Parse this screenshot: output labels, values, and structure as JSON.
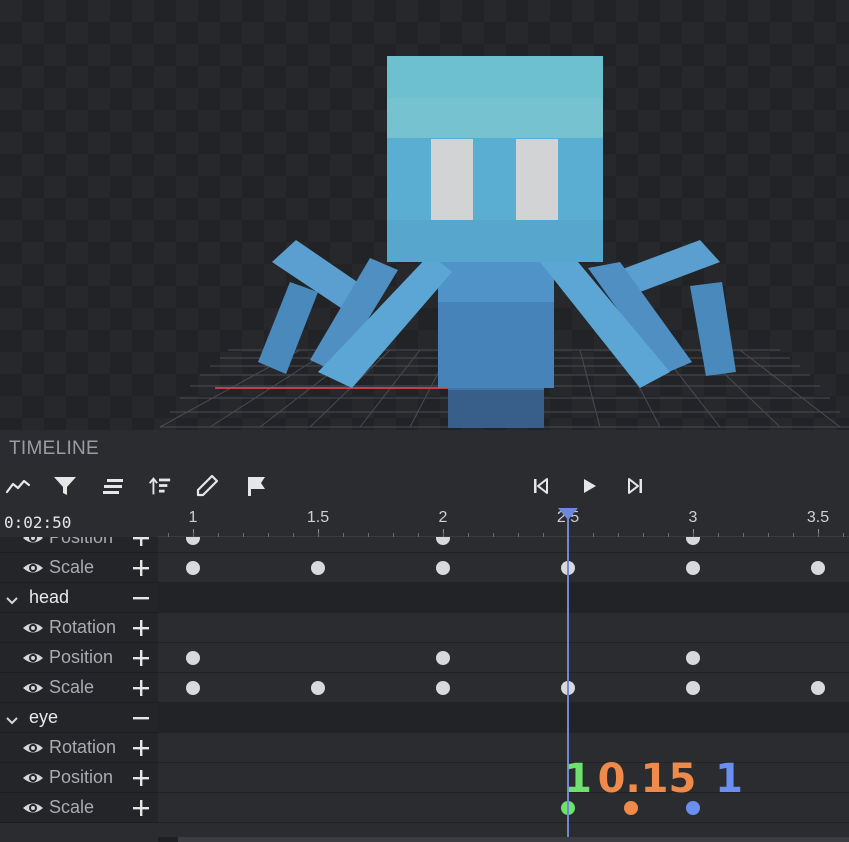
{
  "panel": {
    "title": "TIMELINE"
  },
  "time_readout": "0:02:50",
  "ruler": {
    "ticks": [
      "1",
      "1.5",
      "2",
      "2.5",
      "3",
      "3.5"
    ]
  },
  "toolbar": {
    "left_tools": [
      "graph-editor-icon",
      "filter-icon",
      "align-icon",
      "sort-icon",
      "edit-icon",
      "flag-icon"
    ],
    "playback": [
      "skip-back-icon",
      "play-icon",
      "skip-forward-icon"
    ]
  },
  "rows": [
    {
      "kind": "channel",
      "label": "Position",
      "keyframes": [
        1,
        2,
        3
      ]
    },
    {
      "kind": "channel",
      "label": "Scale",
      "keyframes": [
        1,
        1.5,
        2,
        2.5,
        3,
        3.5
      ]
    },
    {
      "kind": "group",
      "label": "head"
    },
    {
      "kind": "channel",
      "label": "Rotation",
      "keyframes": []
    },
    {
      "kind": "channel",
      "label": "Position",
      "keyframes": [
        1,
        2,
        3
      ]
    },
    {
      "kind": "channel",
      "label": "Scale",
      "keyframes": [
        1,
        1.5,
        2,
        2.5,
        3,
        3.5
      ]
    },
    {
      "kind": "group",
      "label": "eye"
    },
    {
      "kind": "channel",
      "label": "Rotation",
      "keyframes": []
    },
    {
      "kind": "channel",
      "label": "Position",
      "keyframes": []
    },
    {
      "kind": "channel",
      "label": "Scale",
      "keyframes": [
        2.5,
        2.75,
        3
      ]
    }
  ],
  "playhead_time": 2.5,
  "eye_scale_values": [
    {
      "text": "1",
      "color": "#6fe06f"
    },
    {
      "text": "0.15",
      "color": "#f08a4b"
    },
    {
      "text": "1",
      "color": "#6a8ff0"
    }
  ],
  "eye_scale_keyframe_colors": [
    "#6fe06f",
    "#f08a4b",
    "#6a8ff0"
  ],
  "colors": {
    "accent": "#6f88d8",
    "keyframe": "#d8d9dd"
  }
}
